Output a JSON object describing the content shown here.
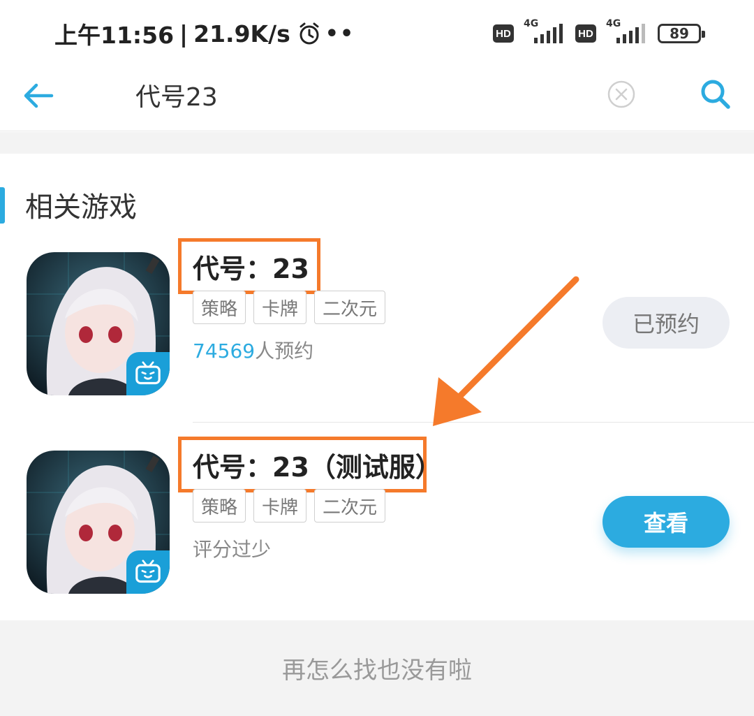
{
  "status_bar": {
    "time": "上午11:56",
    "separator": "|",
    "speed": "21.9K/s",
    "alarm_icon": "alarm-clock-icon",
    "dots": "••",
    "hd_label": "HD",
    "network_label": "4G",
    "battery": "89"
  },
  "search": {
    "query": "代号23",
    "back_icon": "back-arrow-icon",
    "clear_icon": "clear-circle-icon",
    "search_icon": "search-icon"
  },
  "section": {
    "title": "相关游戏"
  },
  "games": [
    {
      "name": "代号：23",
      "tags": [
        "策略",
        "卡牌",
        "二次元"
      ],
      "meta_count": "74569",
      "meta_suffix": "人预约",
      "action": "已预约",
      "badge_icon": "bilibili-tv-icon"
    },
    {
      "name": "代号：23（测试服）",
      "tags": [
        "策略",
        "卡牌",
        "二次元"
      ],
      "meta_text": "评分过少",
      "action": "查看",
      "badge_icon": "bilibili-tv-icon"
    }
  ],
  "footer": {
    "text": "再怎么找也没有啦"
  },
  "colors": {
    "accent": "#2cabe0",
    "highlight": "#f57a2b",
    "reserved_bg": "#eceef3"
  }
}
